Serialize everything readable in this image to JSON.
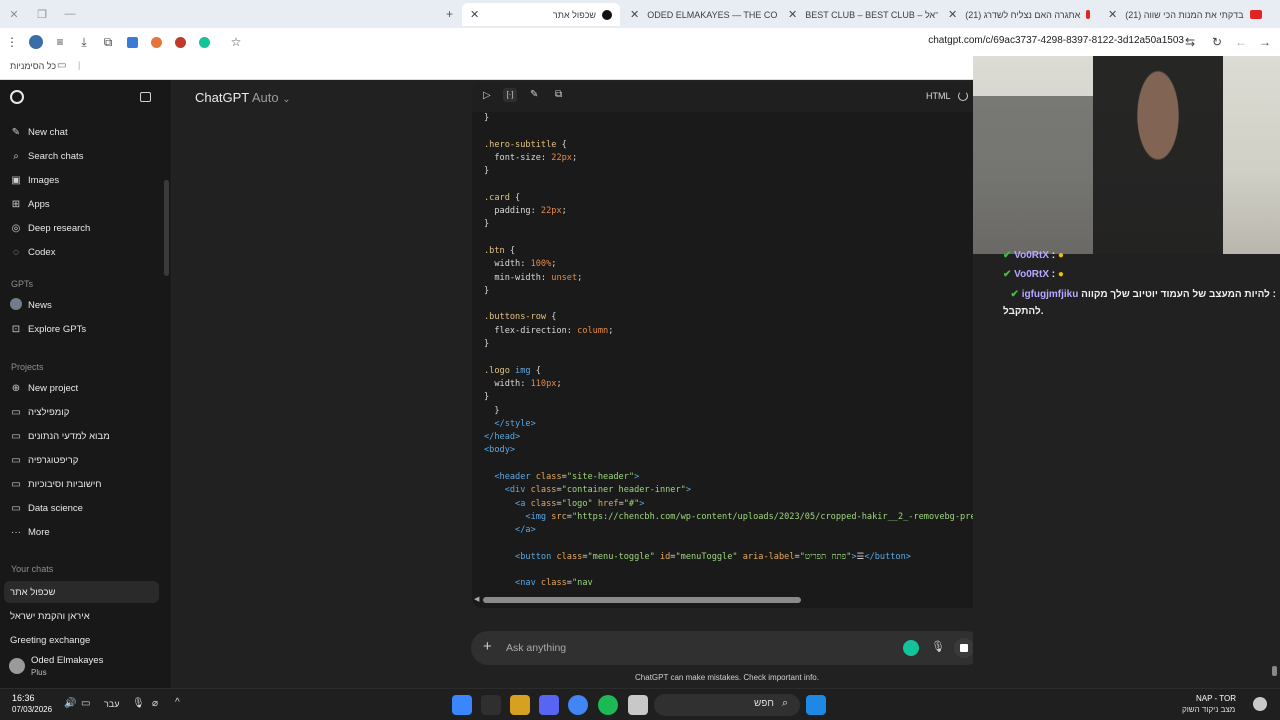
{
  "browser": {
    "tabs": [
      {
        "title": "(21) בדקתי את המנות הכי שווה",
        "fav_color": "#e02424"
      },
      {
        "title": "(21) אתגרה האם נצליח לשדרג",
        "fav_color": "#e02424"
      },
      {
        "title": "BEST CLUB – BEST CLUB – שראל",
        "fav_color": "#2c2c2c"
      },
      {
        "title": "ODED ELMAKAYES — THE COR",
        "fav_color": "#c8c8c8"
      },
      {
        "title": "שכפול אתר",
        "fav_color": "#111111"
      }
    ],
    "url": "chatgpt.com/c/69ac3737-4298-8397-8122-3d12a50a1503",
    "bookmarks_label": "כל הסימניות"
  },
  "sidebar": {
    "items": [
      {
        "label": "New chat",
        "icon": "edit-icon"
      },
      {
        "label": "Search chats",
        "icon": "search-icon"
      },
      {
        "label": "Images",
        "icon": "image-icon"
      },
      {
        "label": "Apps",
        "icon": "grid-icon"
      },
      {
        "label": "Deep research",
        "icon": "telescope-icon"
      },
      {
        "label": "Codex",
        "icon": "codex-icon"
      }
    ],
    "gpts_heading": "GPTs",
    "gpts": [
      {
        "label": "News",
        "icon": "news-avatar-icon"
      },
      {
        "label": "Explore GPTs",
        "icon": "explore-icon"
      }
    ],
    "projects_heading": "Projects",
    "projects": [
      {
        "label": "New project",
        "icon": "folder-plus-icon"
      },
      {
        "label": "קומפילציה",
        "icon": "folder-icon"
      },
      {
        "label": "מבוא למדעי הנתונים",
        "icon": "folder-icon"
      },
      {
        "label": "קריפטוגרפיה",
        "icon": "folder-icon"
      },
      {
        "label": "חישוביות וסיבוכיות",
        "icon": "folder-icon"
      },
      {
        "label": "Data science",
        "icon": "folder-icon"
      },
      {
        "label": "More",
        "icon": "more-icon"
      }
    ],
    "chats_heading": "Your chats",
    "chats": [
      "שכפול אתר",
      "איראן והקמת ישראל",
      "Greeting exchange"
    ],
    "user_name": "Oded Elmakayes",
    "user_plan": "Plus"
  },
  "main": {
    "model_name": "ChatGPT",
    "model_mode": "Auto",
    "code_lang": "HTML",
    "composer_placeholder": "Ask anything",
    "disclaimer": "ChatGPT can make mistakes. Check important info."
  },
  "code_lines": [
    [
      [
        "brace",
        "}"
      ]
    ],
    [],
    [
      [
        "sel",
        ".hero-subtitle"
      ],
      [
        "brace",
        " {"
      ]
    ],
    [
      [
        "prop",
        "  font-size: "
      ],
      [
        "num",
        "22px"
      ],
      [
        "prop",
        ";"
      ]
    ],
    [
      [
        "brace",
        "}"
      ]
    ],
    [],
    [
      [
        "sel",
        ".card"
      ],
      [
        "brace",
        " {"
      ]
    ],
    [
      [
        "prop",
        "  padding: "
      ],
      [
        "num",
        "22px"
      ],
      [
        "prop",
        ";"
      ]
    ],
    [
      [
        "brace",
        "}"
      ]
    ],
    [],
    [
      [
        "sel",
        ".btn"
      ],
      [
        "brace",
        " {"
      ]
    ],
    [
      [
        "prop",
        "  width: "
      ],
      [
        "num",
        "100%"
      ],
      [
        "prop",
        ";"
      ]
    ],
    [
      [
        "prop",
        "  min-width: "
      ],
      [
        "kw",
        "unset"
      ],
      [
        "prop",
        ";"
      ]
    ],
    [
      [
        "brace",
        "}"
      ]
    ],
    [],
    [
      [
        "sel",
        ".buttons-row"
      ],
      [
        "brace",
        " {"
      ]
    ],
    [
      [
        "prop",
        "  flex-direction: "
      ],
      [
        "kw",
        "column"
      ],
      [
        "prop",
        ";"
      ]
    ],
    [
      [
        "brace",
        "}"
      ]
    ],
    [],
    [
      [
        "sel",
        ".logo "
      ],
      [
        "tag",
        "img"
      ],
      [
        "brace",
        " {"
      ]
    ],
    [
      [
        "prop",
        "  width: "
      ],
      [
        "num",
        "110px"
      ],
      [
        "prop",
        ";"
      ]
    ],
    [
      [
        "brace",
        "}"
      ]
    ],
    [
      [
        "brace",
        "  }"
      ]
    ],
    [
      [
        "tag",
        "  </style>"
      ]
    ],
    [
      [
        "tag",
        "</head>"
      ]
    ],
    [
      [
        "tag",
        "<body>"
      ]
    ],
    [],
    [
      [
        "tag",
        "  <header "
      ],
      [
        "attr",
        "class"
      ],
      [
        "prop",
        "="
      ],
      [
        "str",
        "\"site-header\""
      ],
      [
        "tag",
        ">"
      ]
    ],
    [
      [
        "tag",
        "    <div "
      ],
      [
        "attr",
        "class"
      ],
      [
        "prop",
        "="
      ],
      [
        "str",
        "\"container header-inner\""
      ],
      [
        "tag",
        ">"
      ]
    ],
    [
      [
        "tag",
        "      <a "
      ],
      [
        "attr",
        "class"
      ],
      [
        "prop",
        "="
      ],
      [
        "str",
        "\"logo\" "
      ],
      [
        "attr",
        "href"
      ],
      [
        "prop",
        "="
      ],
      [
        "str",
        "\"#\""
      ],
      [
        "tag",
        ">"
      ]
    ],
    [
      [
        "tag",
        "        <img "
      ],
      [
        "attr",
        "src"
      ],
      [
        "prop",
        "="
      ],
      [
        "str",
        "\"https://chencbh.com/wp-content/uploads/2023/05/cropped-hakir__2_-removebg-previ"
      ]
    ],
    [
      [
        "tag",
        "      </a>"
      ]
    ],
    [],
    [
      [
        "tag",
        "      <button "
      ],
      [
        "attr",
        "class"
      ],
      [
        "prop",
        "="
      ],
      [
        "str",
        "\"menu-toggle\" "
      ],
      [
        "attr",
        "id"
      ],
      [
        "prop",
        "="
      ],
      [
        "str",
        "\"menuToggle\" "
      ],
      [
        "attr",
        "aria-label"
      ],
      [
        "prop",
        "="
      ],
      [
        "str",
        "\"פתח תפריט\""
      ],
      [
        "tag",
        ">"
      ],
      [
        "prop",
        "☰"
      ],
      [
        "tag",
        "</button>"
      ]
    ],
    [],
    [
      [
        "tag",
        "      <nav "
      ],
      [
        "attr",
        "class"
      ],
      [
        "prop",
        "="
      ],
      [
        "str",
        "\"nav"
      ]
    ]
  ],
  "live_chat": [
    {
      "user": "Vo0RtX",
      "user_color": "#b8a8ff",
      "message": ":"
    },
    {
      "user": "Vo0RtX",
      "user_color": "#b8a8ff",
      "message": ":"
    },
    {
      "user": "igfugjmfjiku",
      "user_color": "#b8a8ff",
      "message": "להיות המעצב של העמוד יוטיוב שלך מקווה :"
    },
    {
      "user": "",
      "user_color": "#f0f0f0",
      "message": "להתקבל."
    }
  ],
  "taskbar": {
    "time": "16:36",
    "date": "07/03/2026",
    "lang": "עבר",
    "search_placeholder": "חפש",
    "market_title": "NAP - TOR",
    "market_sub": "מצב ניקוד השוק"
  },
  "colors": {
    "accent_green": "#10a37f",
    "link_blue": "#5aa7e0"
  }
}
